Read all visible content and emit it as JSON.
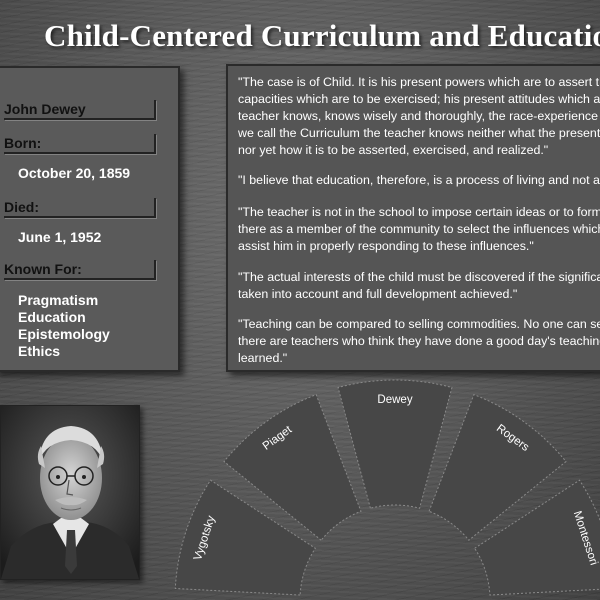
{
  "title": "Child-Centered Curriculum and Education",
  "profile": {
    "name": "John Dewey",
    "born_label": "Born:",
    "born": "October 20, 1859",
    "died_label": "Died:",
    "died": "June 1, 1952",
    "known_label": "Known For:",
    "known_for": [
      "Pragmatism",
      "Education",
      "Epistemology",
      "Ethics"
    ]
  },
  "quotes": [
    [
      "\"The case is of Child. It is his present powers which are to assert themselves; his present",
      "capacities which are to be exercised; his present attitudes which are to be realized. But save as the",
      "teacher knows, knows wisely and thoroughly, the race-experience which is embodied in that thing",
      "we call the Curriculum the teacher knows neither what the present power, capacity, or attitude is,",
      "nor yet how it is to be asserted, exercised, and realized.\""
    ],
    [
      "\"I believe that education, therefore, is a process of living and not a preparation for future living.\""
    ],
    [
      "\"The teacher is not in the school to impose certain ideas or to form certain habits in the child, but is",
      "there as a member of the community to select the influences which shall affect the child and to",
      "assist him in properly responding to these influences.\""
    ],
    [
      "\"The actual interests of the child must be discovered if the significance of his activities is to be",
      "taken into account and full development achieved.\""
    ],
    [
      "\"Teaching can be compared to selling commodities. No one can sell unless someone buys. Yet",
      "there are teachers who think they have done a good day's teaching irrespective of what pupils have",
      "learned.\""
    ]
  ],
  "fan_labels": [
    "Vygotsky",
    "Piaget",
    "Dewey",
    "Rogers",
    "Montessori"
  ]
}
